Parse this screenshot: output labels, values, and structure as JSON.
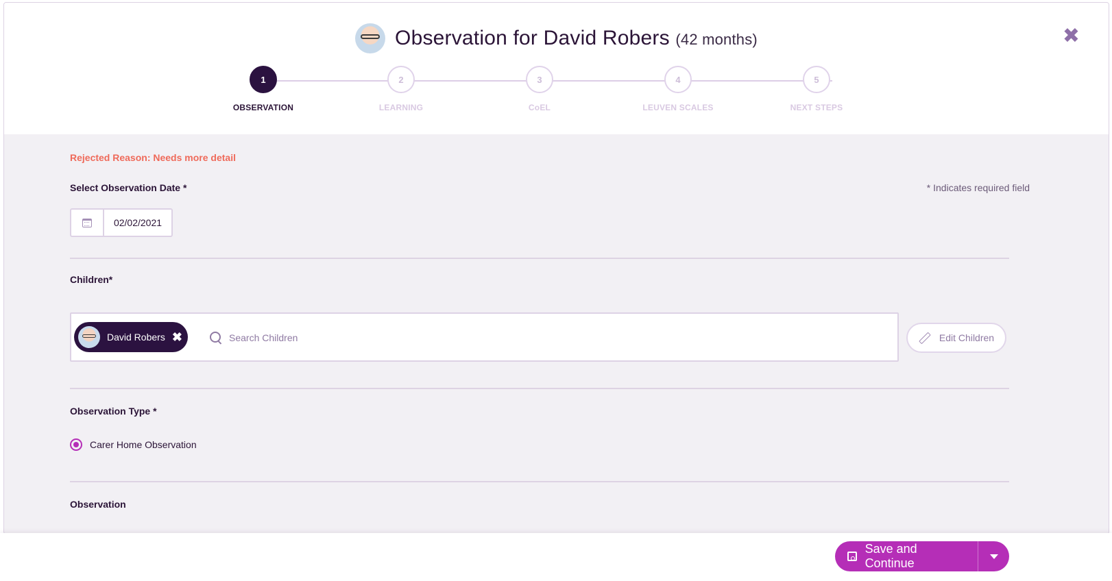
{
  "header": {
    "title_prefix": "Observation for",
    "child_name": "David Robers",
    "child_age": "(42 months)",
    "close_symbol": "✖"
  },
  "stepper": {
    "steps": [
      {
        "number": "1",
        "label": "OBSERVATION"
      },
      {
        "number": "2",
        "label": "LEARNING"
      },
      {
        "number": "3",
        "label": "CoEL"
      },
      {
        "number": "4",
        "label": "LEUVEN SCALES"
      },
      {
        "number": "5",
        "label": "NEXT STEPS"
      }
    ],
    "active": 1
  },
  "form": {
    "rejected_reason": "Rejected Reason: Needs more detail",
    "date_label": "Select Observation Date *",
    "required_note": "* Indicates required field",
    "date_value": "02/02/2021",
    "children_label": "Children*",
    "selected_child": "David Robers",
    "chip_remove": "✖",
    "search_placeholder": "Search Children",
    "edit_children_label": "Edit Children",
    "observation_type_label": "Observation Type *",
    "observation_type_option": "Carer Home Observation",
    "observation_label": "Observation"
  },
  "footer": {
    "save_label": "Save and Continue"
  },
  "colors": {
    "accent": "#b52eb7",
    "primary_dark": "#2b1240",
    "error": "#ef6a5a"
  }
}
